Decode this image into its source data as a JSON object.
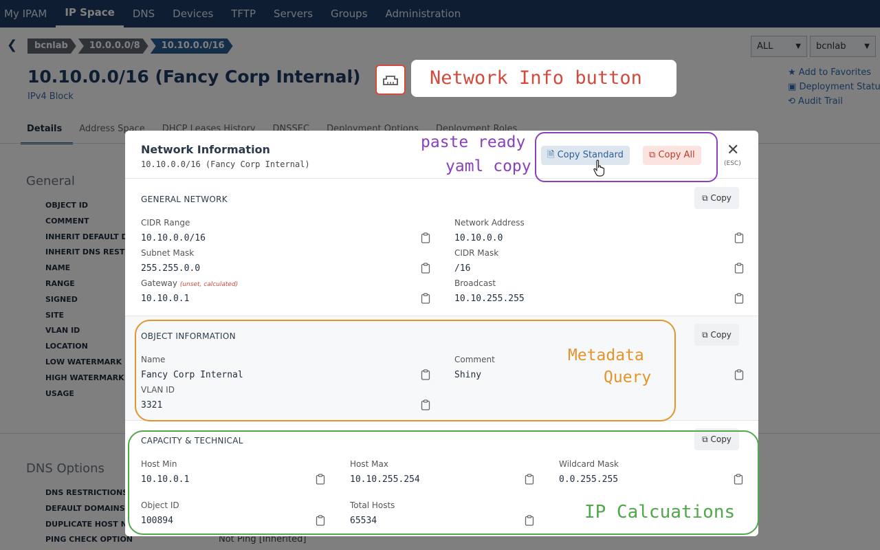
{
  "nav": {
    "items": [
      "My IPAM",
      "IP Space",
      "DNS",
      "Devices",
      "TFTP",
      "Servers",
      "Groups",
      "Administration"
    ],
    "active": "IP Space"
  },
  "breadcrumb": [
    "bcnlab",
    "10.0.0.0/8",
    "10.10.0.0/16"
  ],
  "selects": {
    "scope": "ALL",
    "config": "bcnlab"
  },
  "page": {
    "title": "10.10.0.0/16 (Fancy Corp Internal)",
    "subtitle": "IPv4 Block",
    "quick_links": [
      "Add to Favorites",
      "Deployment Statu",
      "Audit Trail"
    ],
    "tabs": [
      "Details",
      "Address Space",
      "DHCP Leases History",
      "DNSSEC",
      "Deployment Options",
      "Deployment Roles"
    ],
    "general": {
      "heading": "General",
      "fields": [
        "OBJECT ID",
        "COMMENT",
        "INHERIT DEFAULT DO",
        "INHERIT DNS RESTRI",
        "NAME",
        "RANGE",
        "SIGNED",
        "SITE",
        "VLAN ID",
        "LOCATION",
        "LOW WATERMARK",
        "HIGH WATERMARK",
        "USAGE"
      ]
    },
    "dns_options": {
      "heading": "DNS Options",
      "fields": [
        "DNS RESTRICTIONS",
        "DEFAULT DOMAINS",
        "DUPLICATE HOST NA",
        "PING CHECK OPTION"
      ],
      "ping_value": "Not Ping [Inherited]"
    }
  },
  "annotations": {
    "network_info": "Network Info button",
    "paste_ready": [
      "paste ready",
      "yaml copy"
    ],
    "metadata": [
      "Metadata",
      "Query"
    ],
    "ip_calc": "IP Calcuations",
    "colors": {
      "red": "#d24a3c",
      "purple": "#8a3fbf",
      "orange": "#e3952b",
      "green": "#4fa84a"
    }
  },
  "modal": {
    "title": "Network Information",
    "subtitle": "10.10.0.0/16 (Fancy Corp Internal)",
    "copy_standard": "Copy Standard",
    "copy_all": "Copy All",
    "close_hint": "(ESC)",
    "copy_label": "Copy",
    "general": {
      "title": "GENERAL NETWORK",
      "cidr_label": "CIDR Range",
      "cidr_value": "10.10.0.0/16",
      "netaddr_label": "Network Address",
      "netaddr_value": "10.10.0.0",
      "subnet_label": "Subnet Mask",
      "subnet_value": "255.255.0.0",
      "cidrmask_label": "CIDR Mask",
      "cidrmask_value": "/16",
      "gateway_label": "Gateway",
      "gateway_note": "(unset, calculated)",
      "gateway_value": "10.10.0.1",
      "broadcast_label": "Broadcast",
      "broadcast_value": "10.10.255.255"
    },
    "object": {
      "title": "OBJECT INFORMATION",
      "name_label": "Name",
      "name_value": "Fancy Corp Internal",
      "comment_label": "Comment",
      "comment_value": "Shiny",
      "vlan_label": "VLAN ID",
      "vlan_value": "3321"
    },
    "capacity": {
      "title": "CAPACITY & TECHNICAL",
      "hostmin_label": "Host Min",
      "hostmin_value": "10.10.0.1",
      "hostmax_label": "Host Max",
      "hostmax_value": "10.10.255.254",
      "wildcard_label": "Wildcard Mask",
      "wildcard_value": "0.0.255.255",
      "objid_label": "Object ID",
      "objid_value": "100894",
      "total_label": "Total Hosts",
      "total_value": "65534"
    }
  }
}
